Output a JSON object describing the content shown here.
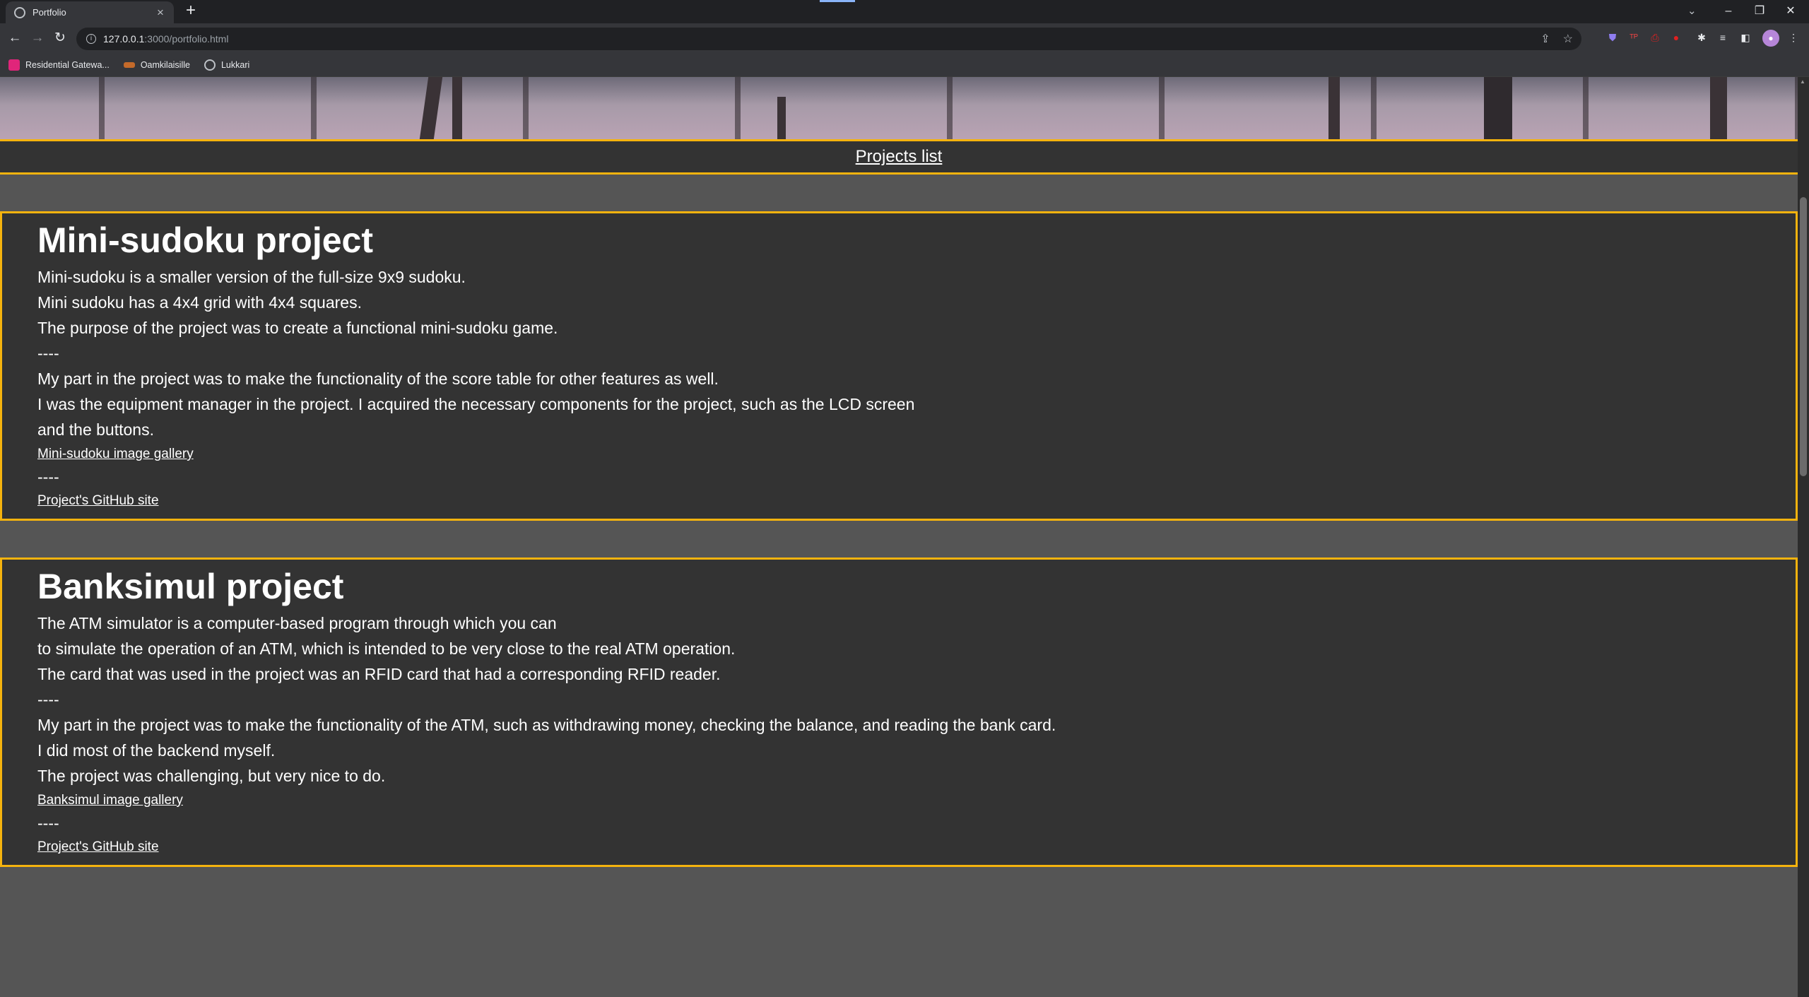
{
  "browser": {
    "tab_title": "Portfolio",
    "url_host": "127.0.0.1",
    "url_path": ":3000/portfolio.html",
    "bookmarks": [
      "Residential Gatewa...",
      "Oamkilaisille",
      "Lukkari"
    ]
  },
  "nav": {
    "projects_link": "Projects list"
  },
  "projects": [
    {
      "title": "Mini-sudoku project",
      "lines": [
        "Mini-sudoku is a smaller version of the full-size 9x9 sudoku.",
        "Mini sudoku has a 4x4 grid with 4x4 squares.",
        "The purpose of the project was to create a functional mini-sudoku game.",
        "----",
        "My part in the project was to make the functionality of the score table for other features as well.",
        "I was the equipment manager in the project. I acquired the necessary components for the project, such as the LCD screen",
        "and the buttons."
      ],
      "gallery_link": "Mini-sudoku image gallery",
      "separator": "----",
      "github_link": "Project's GitHub site"
    },
    {
      "title": "Banksimul project",
      "lines": [
        "The ATM simulator is a computer-based program through which you can",
        "to simulate the operation of an ATM, which is intended to be very close to the real ATM operation.",
        "The card that was used in the project was an RFID card that had a corresponding RFID reader.",
        "----",
        "My part in the project was to make the functionality of the ATM, such as withdrawing money, checking the balance, and reading the bank card.",
        "I did most of the backend myself.",
        "The project was challenging, but very nice to do."
      ],
      "gallery_link": "Banksimul image gallery",
      "separator": "----",
      "github_link": "Project's GitHub site"
    }
  ],
  "colors": {
    "accent_border": "#f5b30e",
    "panel": "#333333",
    "background": "#555555"
  }
}
